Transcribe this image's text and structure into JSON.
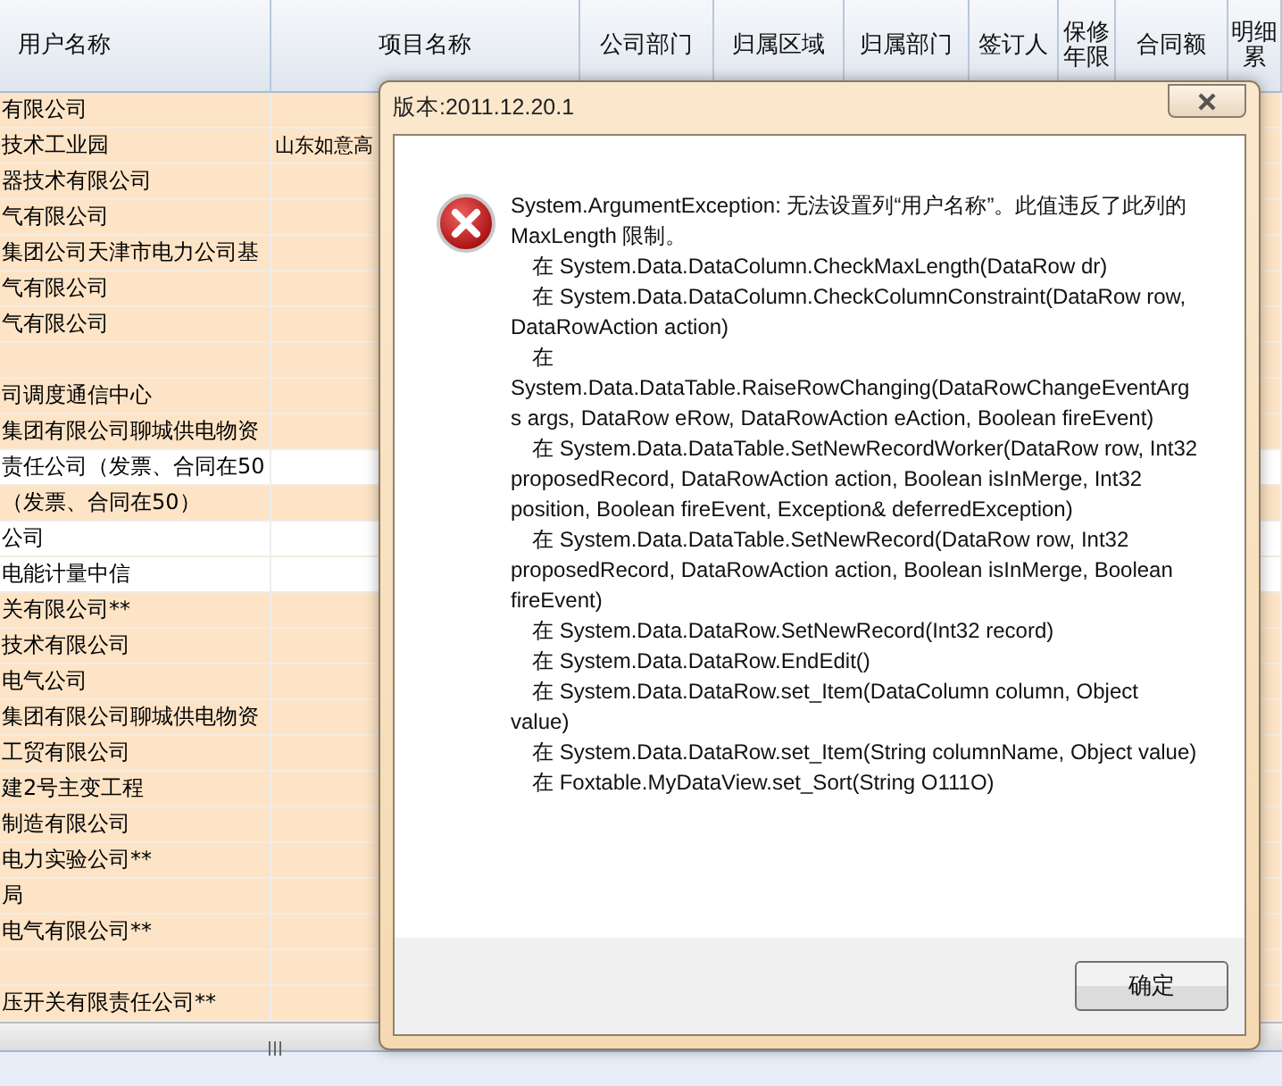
{
  "table": {
    "columns": [
      "用户名称",
      "项目名称",
      "公司部门",
      "归属区域",
      "归属部门",
      "签订人",
      "保修年限",
      "合同额",
      "明细累"
    ],
    "rows": [
      {
        "cells": [
          "有限公司"
        ],
        "highlighted": true
      },
      {
        "cells": [
          "技术工业园",
          "山东如意高"
        ],
        "highlighted": true
      },
      {
        "cells": [
          "器技术有限公司"
        ],
        "highlighted": true
      },
      {
        "cells": [
          "气有限公司"
        ],
        "highlighted": true
      },
      {
        "cells": [
          "集团公司天津市电力公司基"
        ],
        "highlighted": true
      },
      {
        "cells": [
          "气有限公司"
        ],
        "highlighted": true
      },
      {
        "cells": [
          "气有限公司"
        ],
        "highlighted": true
      },
      {
        "cells": [],
        "highlighted": true
      },
      {
        "cells": [
          "司调度通信中心"
        ],
        "highlighted": true
      },
      {
        "cells": [
          "集团有限公司聊城供电物资"
        ],
        "highlighted": true
      },
      {
        "cells": [
          "责任公司（发票、合同在50"
        ],
        "highlighted": false
      },
      {
        "cells": [
          "（发票、合同在50）"
        ],
        "highlighted": true
      },
      {
        "cells": [
          "公司"
        ],
        "highlighted": false
      },
      {
        "cells": [
          "电能计量中信"
        ],
        "highlighted": false
      },
      {
        "cells": [
          "关有限公司**"
        ],
        "highlighted": true
      },
      {
        "cells": [
          "技术有限公司"
        ],
        "highlighted": true
      },
      {
        "cells": [
          "电气公司"
        ],
        "highlighted": true
      },
      {
        "cells": [
          "集团有限公司聊城供电物资"
        ],
        "highlighted": true
      },
      {
        "cells": [
          "工贸有限公司"
        ],
        "highlighted": true
      },
      {
        "cells": [
          "建2号主变工程"
        ],
        "highlighted": true
      },
      {
        "cells": [
          "制造有限公司"
        ],
        "highlighted": true
      },
      {
        "cells": [
          "电力实验公司**"
        ],
        "highlighted": true
      },
      {
        "cells": [
          "局"
        ],
        "highlighted": true
      },
      {
        "cells": [
          "电气有限公司**"
        ],
        "highlighted": true
      },
      {
        "cells": [],
        "highlighted": true
      },
      {
        "cells": [
          "压开关有限责任公司**"
        ],
        "highlighted": true
      }
    ]
  },
  "dialog": {
    "title": "版本:2011.12.20.1",
    "message": [
      {
        "kind": "error",
        "text": "System.ArgumentException: 无法设置列“用户名称”。此值违反了此列的 MaxLength 限制。"
      },
      {
        "kind": "frame",
        "text": "在 System.Data.DataColumn.CheckMaxLength(DataRow dr)"
      },
      {
        "kind": "frame",
        "text": "在 System.Data.DataColumn.CheckColumnConstraint(DataRow row, DataRowAction action)"
      },
      {
        "kind": "frame",
        "text": "在 System.Data.DataTable.RaiseRowChanging(DataRowChangeEventArgs args, DataRow eRow, DataRowAction eAction, Boolean fireEvent)"
      },
      {
        "kind": "frame",
        "text": "在 System.Data.DataTable.SetNewRecordWorker(DataRow row, Int32 proposedRecord, DataRowAction action, Boolean isInMerge, Int32 position, Boolean fireEvent, Exception& deferredException)"
      },
      {
        "kind": "frame",
        "text": "在 System.Data.DataTable.SetNewRecord(DataRow row, Int32 proposedRecord, DataRowAction action, Boolean isInMerge, Boolean fireEvent)"
      },
      {
        "kind": "frame",
        "text": "在 System.Data.DataRow.SetNewRecord(Int32 record)"
      },
      {
        "kind": "frame",
        "text": "在 System.Data.DataRow.EndEdit()"
      },
      {
        "kind": "frame",
        "text": "在 System.Data.DataRow.set_Item(DataColumn column, Object value)"
      },
      {
        "kind": "frame",
        "text": "在 System.Data.DataRow.set_Item(String columnName, Object value)"
      },
      {
        "kind": "frame",
        "text": "在 Foxtable.MyDataView.set_Sort(String O111O)"
      }
    ],
    "button": "确定"
  }
}
